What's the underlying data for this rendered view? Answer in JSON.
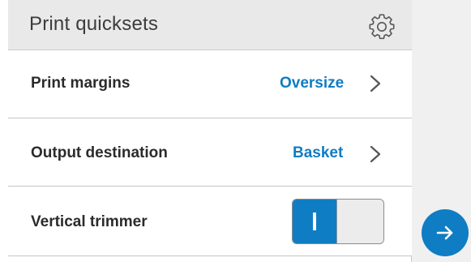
{
  "header": {
    "title": "Print quicksets",
    "settings_icon": "gear-icon"
  },
  "rows": [
    {
      "label": "Print margins",
      "value": "Oversize",
      "icon": "chevron-right-icon"
    },
    {
      "label": "Output destination",
      "value": "Basket",
      "icon": "chevron-right-icon"
    },
    {
      "label": "Vertical trimmer",
      "toggle_state": "on",
      "toggle_on_glyph": "|"
    }
  ],
  "next_button": {
    "icon": "arrow-right-icon"
  },
  "colors": {
    "accent": "#0f7dc3",
    "header_bg": "#e9e9e9",
    "panel_bg": "#ffffff",
    "screen_bg": "#f0f0f0",
    "label_text": "#2b2b2b"
  }
}
